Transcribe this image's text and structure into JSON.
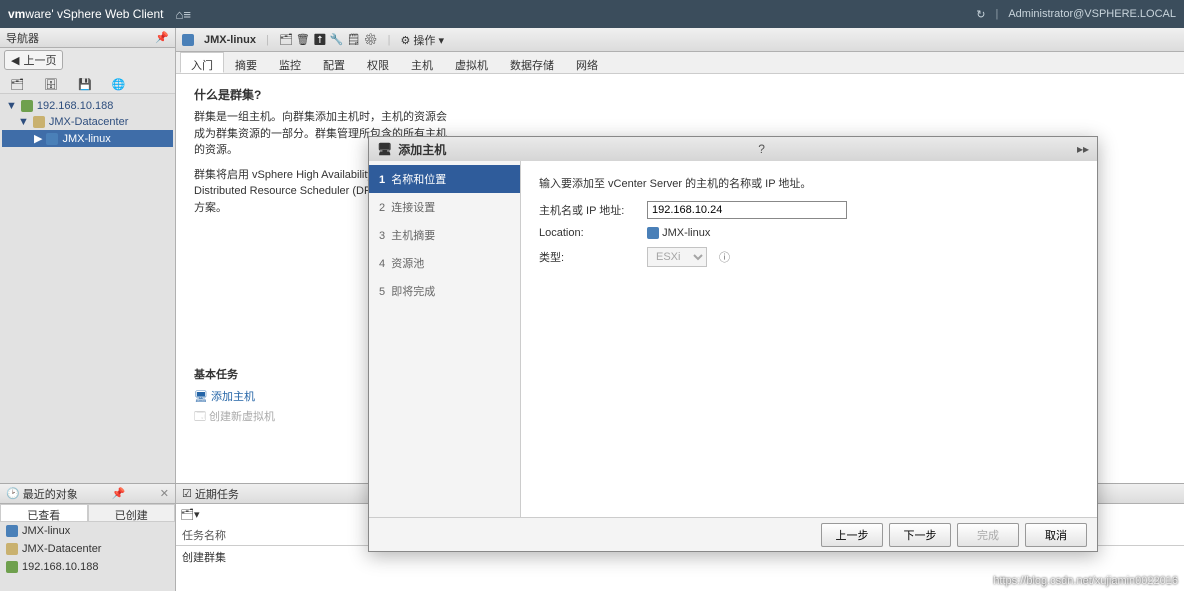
{
  "topbar": {
    "brand_bold": "vm",
    "brand_rest": "ware' vSphere Web Client",
    "home_glyph": "⌂≡",
    "refresh_glyph": "↻",
    "user": "Administrator@VSPHERE.LOCAL"
  },
  "navigator": {
    "title": "导航器",
    "back_label": "上一页",
    "chevron_left": "◀",
    "tree": {
      "root_ip": "192.168.10.188",
      "datacenter": "JMX-Datacenter",
      "cluster": "JMX-linux",
      "caret_down": "▼",
      "caret_right": "▶"
    }
  },
  "content": {
    "crumb": "JMX-linux",
    "actions_label": "操作",
    "tabs": [
      "入门",
      "摘要",
      "监控",
      "配置",
      "权限",
      "主机",
      "虚拟机",
      "数据存储",
      "网络"
    ],
    "getting_started": {
      "q_title": "什么是群集?",
      "para1": "群集是一组主机。向群集添加主机时，主机的资源会成为群集资源的一部分。群集管理所包含的所有主机的资源。",
      "para2": "群集将启用 vSphere High Availability (HA)、vSphere Distributed Resource Scheduler (DRS) 和 vSAN 解决方案。",
      "basic_title": "基本任务",
      "task_add_host": "添加主机",
      "task_new_vm": "创建新虚拟机"
    }
  },
  "recent_objects": {
    "title": "最近的对象",
    "tab_viewed": "已查看",
    "tab_created": "已创建",
    "items": [
      "JMX-linux",
      "JMX-Datacenter",
      "192.168.10.188"
    ],
    "close_glyph": "✕",
    "pin_glyph": "📌"
  },
  "recent_tasks": {
    "title": "近期任务",
    "col_name": "任务名称",
    "row0": "创建群集"
  },
  "modal": {
    "title": "添加主机",
    "help_glyph": "?",
    "expand_glyph": "▸▸",
    "steps": [
      {
        "num": "1",
        "label": "名称和位置"
      },
      {
        "num": "2",
        "label": "连接设置"
      },
      {
        "num": "3",
        "label": "主机摘要"
      },
      {
        "num": "4",
        "label": "资源池"
      },
      {
        "num": "5",
        "label": "即将完成"
      }
    ],
    "instruction": "输入要添加至 vCenter Server 的主机的名称或 IP 地址。",
    "field_host_label": "主机名或 IP 地址:",
    "field_host_value": "192.168.10.24",
    "field_location_label": "Location:",
    "field_location_value": "JMX-linux",
    "field_type_label": "类型:",
    "field_type_value": "ESXi",
    "info_glyph": "ⓘ",
    "btn_back": "上一步",
    "btn_next": "下一步",
    "btn_finish": "完成",
    "btn_cancel": "取消"
  },
  "watermark": "https://blog.csdn.net/xujiamin0022016"
}
